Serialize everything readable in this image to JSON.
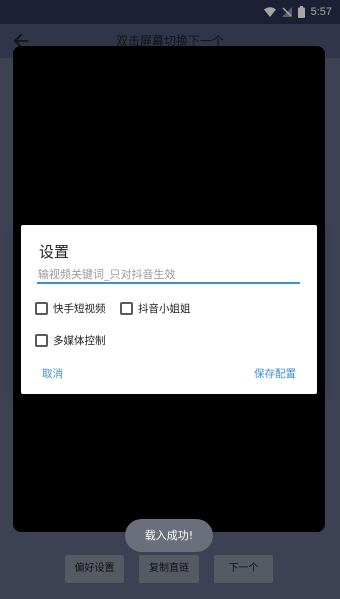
{
  "status": {
    "time": "5:57"
  },
  "app": {
    "title": "双击屏幕切换下一个"
  },
  "dialog": {
    "title": "设置",
    "keyword_placeholder": "输视频关键词_只对抖音生效",
    "keyword_value": "",
    "options": [
      {
        "label": "快手短视频",
        "checked": false
      },
      {
        "label": "抖音小姐姐",
        "checked": false
      },
      {
        "label": "多媒体控制",
        "checked": false
      }
    ],
    "cancel_label": "取消",
    "save_label": "保存配置"
  },
  "toast": {
    "text": "载入成功!"
  },
  "bottom": {
    "prefs_label": "偏好设置",
    "copy_link_label": "复制直链",
    "next_label": "下一个"
  },
  "colors": {
    "accent": "#3b8fd6",
    "status_bar": "#2d3150",
    "app_bar": "#4b5270",
    "background": "#5c6480",
    "video": "#000000"
  }
}
